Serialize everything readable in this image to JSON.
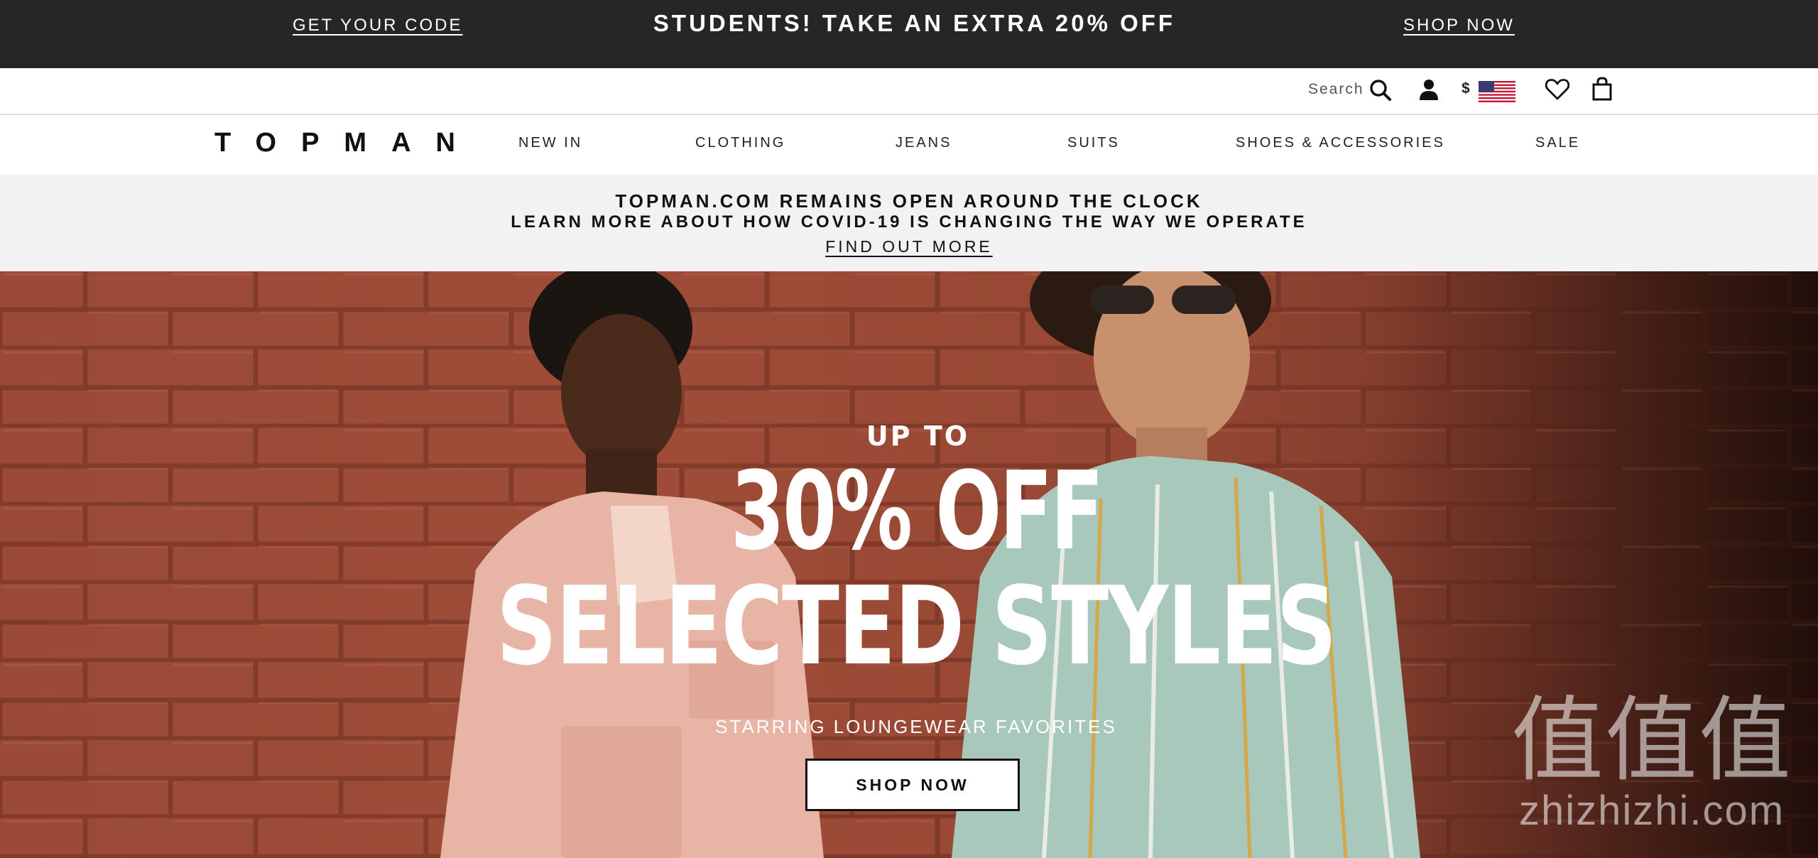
{
  "promo": {
    "left_link": "GET YOUR CODE",
    "headline": "STUDENTS! TAKE AN EXTRA 20% OFF",
    "right_link": "SHOP NOW"
  },
  "utility": {
    "search_label": "Search",
    "currency_symbol": "$",
    "icons": [
      "search-icon",
      "account-icon",
      "us-flag-icon",
      "wishlist-heart-icon",
      "shopping-bag-icon"
    ]
  },
  "nav": {
    "logo": "TOPMAN",
    "items": [
      "NEW IN",
      "CLOTHING",
      "JEANS",
      "SUITS",
      "SHOES & ACCESSORIES",
      "SALE"
    ]
  },
  "notice": {
    "line1": "TOPMAN.COM REMAINS OPEN AROUND THE CLOCK",
    "line2": "LEARN MORE ABOUT HOW COVID-19 IS CHANGING THE WAY WE OPERATE",
    "link": "FIND OUT MORE"
  },
  "hero": {
    "pre_title": "UP TO",
    "title_line1": "30% OFF",
    "title_line2": "SELECTED STYLES",
    "subtitle": "STARRING LOUNGEWEAR FAVORITES",
    "button": "SHOP NOW"
  },
  "watermark": {
    "top": "值值值",
    "bottom": "zhizhizhi.com"
  },
  "colors": {
    "promo_bg": "#262626",
    "notice_bg": "#f2f2f2",
    "hero_brick": "#9e4c38",
    "text_dark": "#111111"
  }
}
